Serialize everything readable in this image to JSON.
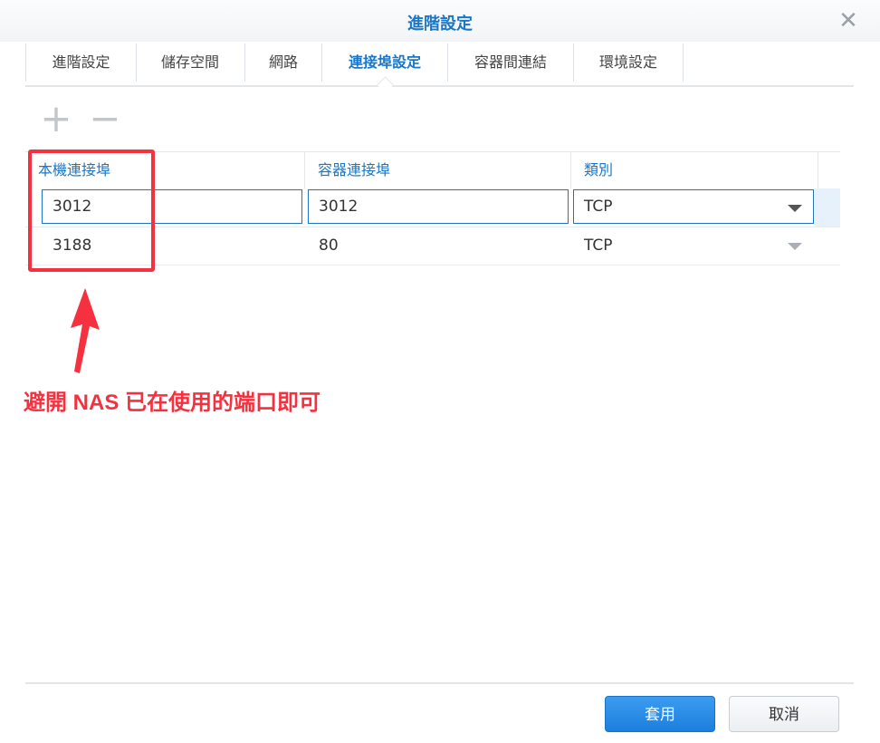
{
  "dialog": {
    "title": "進階設定",
    "close_icon": "close-icon"
  },
  "tabs": [
    {
      "label": "進階設定"
    },
    {
      "label": "儲存空間"
    },
    {
      "label": "網路"
    },
    {
      "label": "連接埠設定"
    },
    {
      "label": "容器間連結"
    },
    {
      "label": "環境設定"
    }
  ],
  "active_tab": "連接埠設定",
  "toolbar": {
    "add_icon": "plus-icon",
    "remove_icon": "minus-icon",
    "add_glyph": "+",
    "remove_glyph": "−"
  },
  "grid": {
    "columns": [
      "本機連接埠",
      "容器連接埠",
      "類別"
    ],
    "rows": [
      {
        "local_port": "3012",
        "container_port": "3012",
        "type": "TCP",
        "editing": true
      },
      {
        "local_port": "3188",
        "container_port": "80",
        "type": "TCP",
        "editing": false
      }
    ]
  },
  "annotation": {
    "text": "避開 NAS 已在使用的端口即可",
    "color": "#f5303f"
  },
  "footer": {
    "apply_label": "套用",
    "cancel_label": "取消"
  },
  "colors": {
    "accent": "#1a77c8",
    "primary_button": "#2a8ce6"
  }
}
